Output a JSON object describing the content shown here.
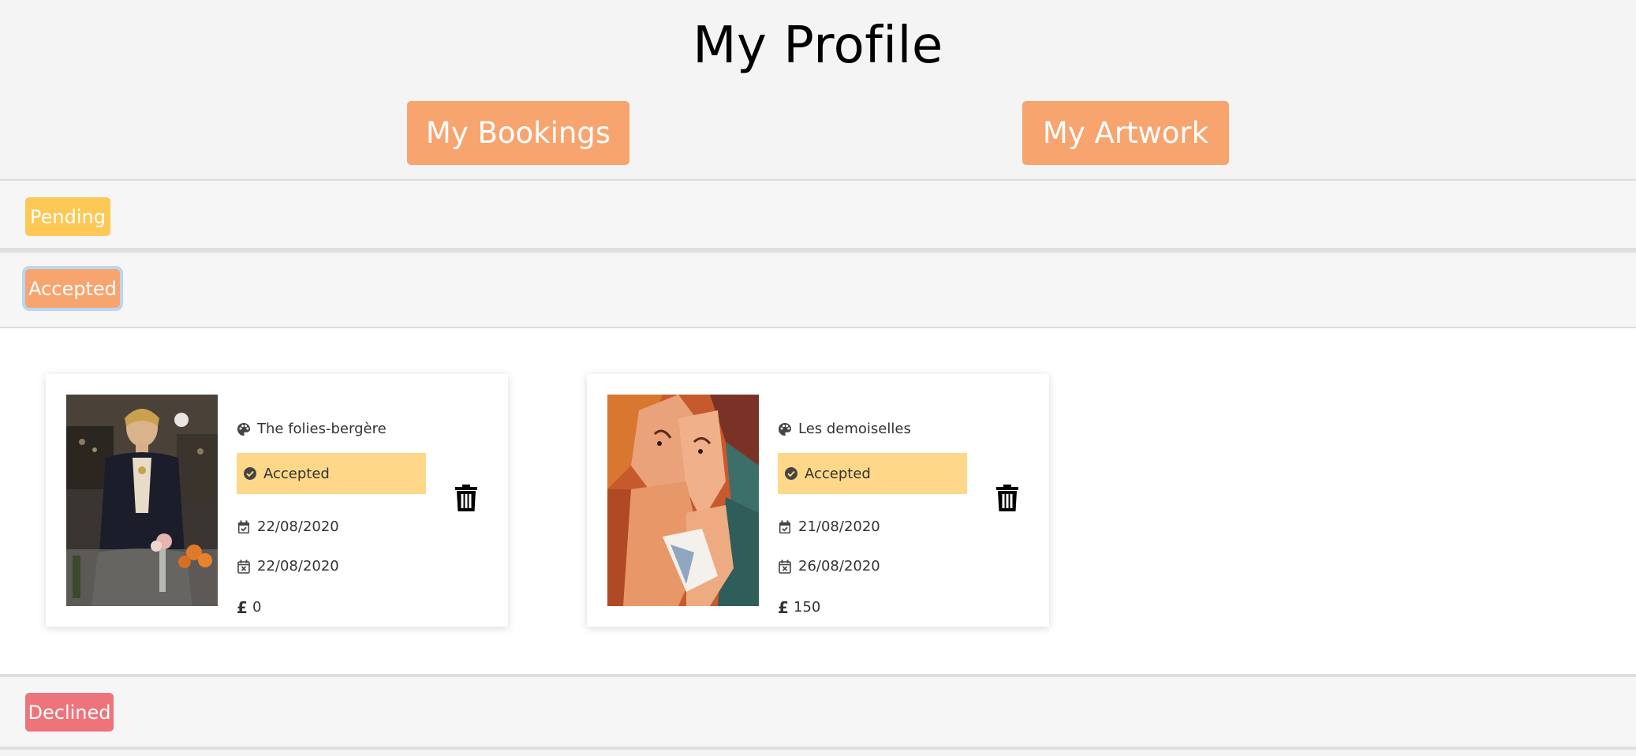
{
  "page": {
    "title": "My Profile"
  },
  "nav": {
    "bookings_label": "My Bookings",
    "artwork_label": "My Artwork"
  },
  "sections": {
    "pending_label": "Pending",
    "accepted_label": "Accepted",
    "declined_label": "Declined"
  },
  "colors": {
    "nav_button": "#f7a46f",
    "pending": "#fdc856",
    "accepted": "#f7a46f",
    "declined": "#ee747b",
    "status_badge": "#fed888"
  },
  "bookings": [
    {
      "artwork": "The folies-bergère",
      "status": "Accepted",
      "start_date": "22/08/2020",
      "end_date": "22/08/2020",
      "currency": "£",
      "price": "0",
      "image_icon": "painting-thumbnail"
    },
    {
      "artwork": "Les demoiselles",
      "status": "Accepted",
      "start_date": "21/08/2020",
      "end_date": "26/08/2020",
      "currency": "£",
      "price": "150",
      "image_icon": "painting-thumbnail"
    }
  ],
  "icons": {
    "artwork": "palette-icon",
    "status": "check-circle-icon",
    "start_date": "calendar-check-icon",
    "end_date": "calendar-times-icon",
    "price": "pound-icon",
    "delete": "trash-icon"
  }
}
